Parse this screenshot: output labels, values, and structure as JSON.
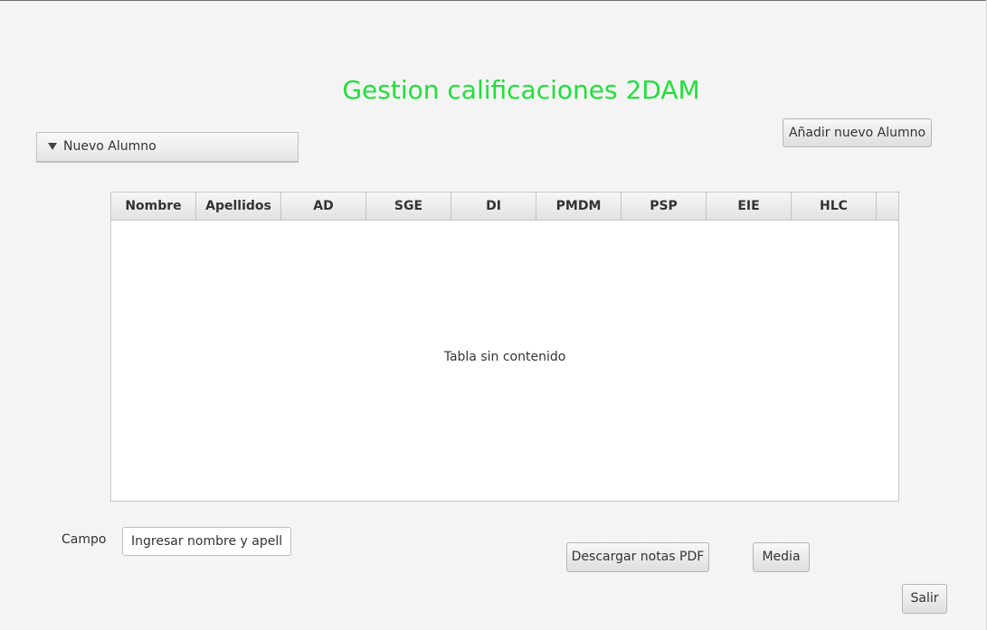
{
  "header": {
    "title": "Gestion calificaciones 2DAM",
    "title_color": "#21e03a"
  },
  "toolbar": {
    "add_student_label": "Añadir nuevo Alumno"
  },
  "new_student_pane": {
    "label": "Nuevo Alumno",
    "expanded": false,
    "arrow_icon": "triangle-down-icon"
  },
  "table": {
    "columns": [
      "Nombre",
      "Apellidos",
      "AD",
      "SGE",
      "DI",
      "PMDM",
      "PSP",
      "EIE",
      "HLC"
    ],
    "rows": [],
    "empty_message": "Tabla sin contenido"
  },
  "search": {
    "label": "Campo",
    "placeholder": "Ingresar nombre y apellido",
    "value": ""
  },
  "actions": {
    "download_pdf_label": "Descargar notas PDF",
    "average_label": "Media",
    "exit_label": "Salir"
  }
}
